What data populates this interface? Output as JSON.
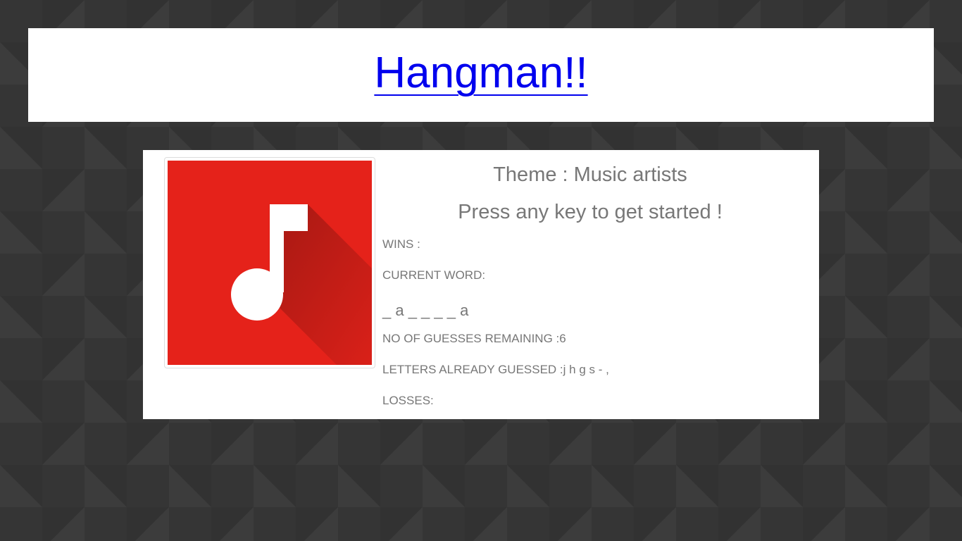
{
  "header": {
    "title": "Hangman!!"
  },
  "album": {
    "icon": "music-note-icon",
    "background_color": "#e5221a"
  },
  "game": {
    "theme_label": "Theme : Music artists",
    "prompt": "Press any key to get started !",
    "wins_label": "WINS :",
    "current_word_label": "CURRENT WORD:",
    "current_word": "_ a _ _ _ _ a",
    "guesses_remaining_label": "NO OF GUESSES REMAINING :6",
    "letters_guessed_label": "LETTERS ALREADY GUESSED :j h g s - ,",
    "losses_label": "LOSSES:"
  },
  "colors": {
    "page_background": "#353535",
    "link": "#0000ee",
    "text": "#777777",
    "album_red": "#e5221a"
  }
}
